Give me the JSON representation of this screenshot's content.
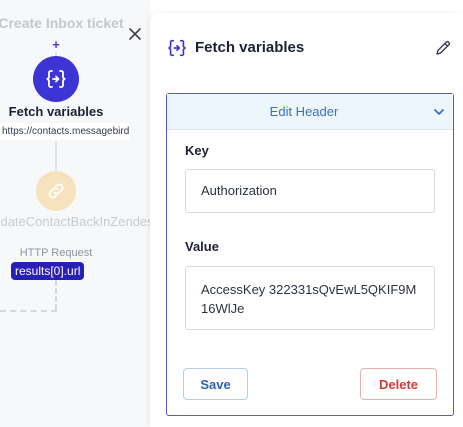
{
  "canvas": {
    "prev_node_label": "Create Inbox ticket",
    "add_icon": "+",
    "current_node": {
      "icon": "variable-braces-icon",
      "title": "Fetch variables",
      "url": "https://contacts.messagebird.com"
    },
    "next_node": {
      "icon": "link-icon",
      "title": "updateContactBackInZendesk",
      "subtitle": "HTTP Request",
      "result_tag": "results[0].url"
    },
    "close_icon": "close-icon"
  },
  "panel": {
    "title": "Fetch variables",
    "title_icon": "variable-braces-icon",
    "edit_icon": "pencil-icon",
    "section": {
      "header_label": "Edit Header",
      "header_icon": "chevron-down-icon",
      "key_label": "Key",
      "key_value": "Authorization",
      "value_label": "Value",
      "value_value": "AccessKey 322331sQvEwL5QKIF9M16WlJe"
    },
    "save_label": "Save",
    "delete_label": "Delete"
  },
  "colors": {
    "accent": "#3d34d6",
    "tag_bg": "#2a1fb5",
    "card_border": "#5a52e0",
    "link_blue": "#3a6fc4",
    "delete_red": "#d23b3b",
    "next_node_bg": "#f6e3bd"
  }
}
